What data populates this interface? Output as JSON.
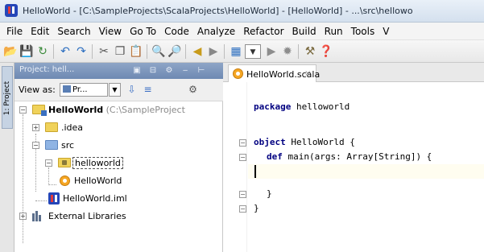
{
  "window": {
    "title": "HelloWorld - [C:\\SampleProjects\\ScalaProjects\\HelloWorld] - [HelloWorld] - ...\\src\\hellowo"
  },
  "menu": [
    "File",
    "Edit",
    "Search",
    "View",
    "Go To",
    "Code",
    "Analyze",
    "Refactor",
    "Build",
    "Run",
    "Tools",
    "V"
  ],
  "toolbar": {
    "icons": [
      "open-folder-icon",
      "save-icon",
      "sync-icon",
      "undo-icon",
      "redo-icon",
      "cut-icon",
      "copy-icon",
      "paste-icon",
      "find-icon",
      "replace-icon",
      "navigate-back-icon",
      "navigate-forward-icon",
      "project-structure-icon",
      "run-config-dropdown-icon",
      "run-icon",
      "debug-icon",
      "settings-icon",
      "help-icon"
    ]
  },
  "left_strip": {
    "project_tab_label": "1: Project"
  },
  "project_panel": {
    "header_title": "Project: hell...",
    "view_as_label": "View as:",
    "view_as_value": "Pr...",
    "tree": {
      "root_name": "HelloWorld",
      "root_path": "(C:\\SampleProject",
      "idea": ".idea",
      "src": "src",
      "package": "helloworld",
      "object": "HelloWorld",
      "iml": "HelloWorld.iml",
      "libraries": "External Libraries"
    }
  },
  "editor": {
    "tab_label": "HelloWorld.scala",
    "tab_close": "×",
    "code": {
      "line1_kw": "package",
      "line1_rest": " helloworld",
      "line2_kw": "object",
      "line2_rest": " HelloWorld {",
      "line3_kw": "def",
      "line3_rest": " main(args: Array[String]) {",
      "line5": "}",
      "line6": "}"
    }
  }
}
